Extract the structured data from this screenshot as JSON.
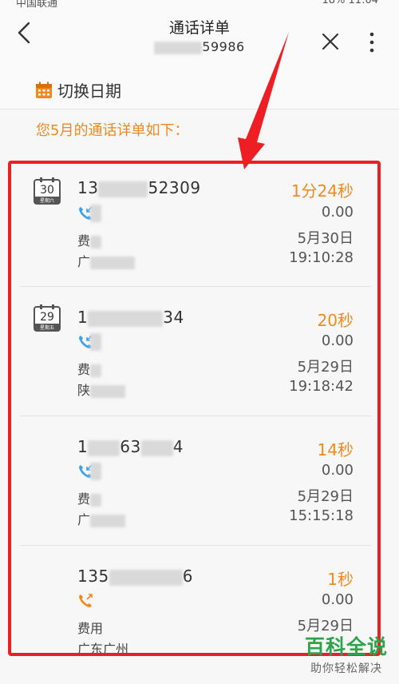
{
  "status_bar": {
    "carrier": "中国联通",
    "battery": "18%",
    "time": "11:04"
  },
  "header": {
    "title": "通话详单",
    "subtitle_suffix": "59986"
  },
  "toolbar": {
    "switch_date_label": "切换日期"
  },
  "summary": "您5月的通话详单如下：",
  "calls": [
    {
      "number_prefix": "13",
      "number_suffix": "52309",
      "duration": "1分24秒",
      "fee": "0.00",
      "date": "5月30日",
      "time": "19:10:28",
      "fee_label": "费",
      "location": "广",
      "calendar_day": "30",
      "calendar_weekday": "星期六",
      "direction": "incoming"
    },
    {
      "number_prefix": "1",
      "number_suffix": "34",
      "duration": "20秒",
      "fee": "0.00",
      "date": "5月29日",
      "time": "19:18:42",
      "fee_label": "费",
      "location": "陕",
      "calendar_day": "29",
      "calendar_weekday": "星期五",
      "direction": "incoming"
    },
    {
      "number_prefix": "1",
      "number_mid": "63",
      "number_suffix": "4",
      "duration": "14秒",
      "fee": "0.00",
      "date": "5月29日",
      "time": "15:15:18",
      "fee_label": "费",
      "location": "广",
      "direction": "incoming"
    },
    {
      "number_prefix": "135",
      "number_suffix": "6",
      "duration": "1秒",
      "fee": "0.00",
      "date": "5月29日",
      "time": "",
      "fee_label": "费用",
      "location": "广东广州",
      "direction": "outgoing"
    }
  ],
  "watermark": {
    "title": "百科全说",
    "subtitle": "助你轻松解决"
  },
  "colors": {
    "accent": "#f08a1c",
    "highlight_box": "#ee1f24",
    "incoming_icon": "#3aa0e8",
    "outgoing_icon": "#f08a1c",
    "watermark": "#2fa34a"
  }
}
